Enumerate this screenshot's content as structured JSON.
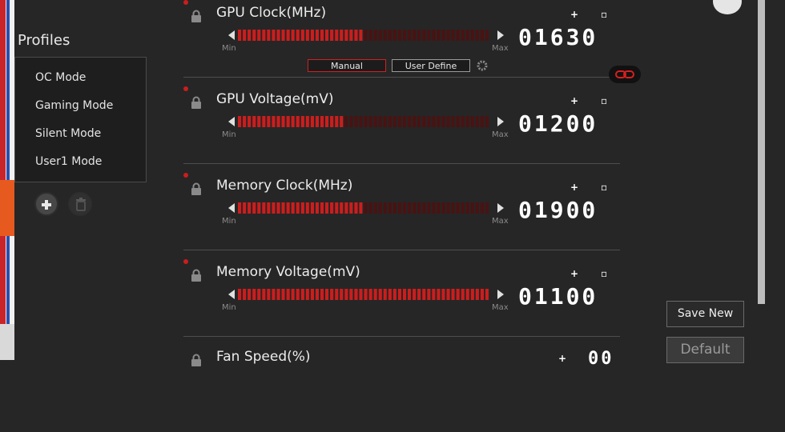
{
  "profiles": {
    "title": "Profiles",
    "items": [
      {
        "label": "OC Mode"
      },
      {
        "label": "Gaming Mode"
      },
      {
        "label": "Silent Mode"
      },
      {
        "label": "User1 Mode"
      }
    ]
  },
  "sliders": [
    {
      "label": "GPU Clock(MHz)",
      "value": "01630",
      "min_label": "Min",
      "max_label": "Max",
      "plus": "+",
      "minus": "▫",
      "level": 0.5
    },
    {
      "label": "GPU Voltage(mV)",
      "value": "01200",
      "min_label": "Min",
      "max_label": "Max",
      "plus": "+",
      "minus": "▫",
      "level": 0.43
    },
    {
      "label": "Memory Clock(MHz)",
      "value": "01900",
      "min_label": "Min",
      "max_label": "Max",
      "plus": "+",
      "minus": "▫",
      "level": 0.5
    },
    {
      "label": "Memory Voltage(mV)",
      "value": "01100",
      "min_label": "Min",
      "max_label": "Max",
      "plus": "+",
      "minus": "▫",
      "level": 1.0
    },
    {
      "label": "Fan Speed(%)",
      "value": "00",
      "plus": "+",
      "minus": "▫"
    }
  ],
  "mode_buttons": {
    "manual": "Manual",
    "user_define": "User Define"
  },
  "right_buttons": {
    "save_new": "Save New",
    "default": "Default"
  },
  "colors": {
    "accent": "#cc1d1d",
    "track_inactive": "#4a1212",
    "background": "#262626"
  },
  "icons": {
    "lock": "lock-icon",
    "gear": "gear-icon",
    "link": "link-icon",
    "add": "add-icon",
    "trash": "trash-icon"
  }
}
